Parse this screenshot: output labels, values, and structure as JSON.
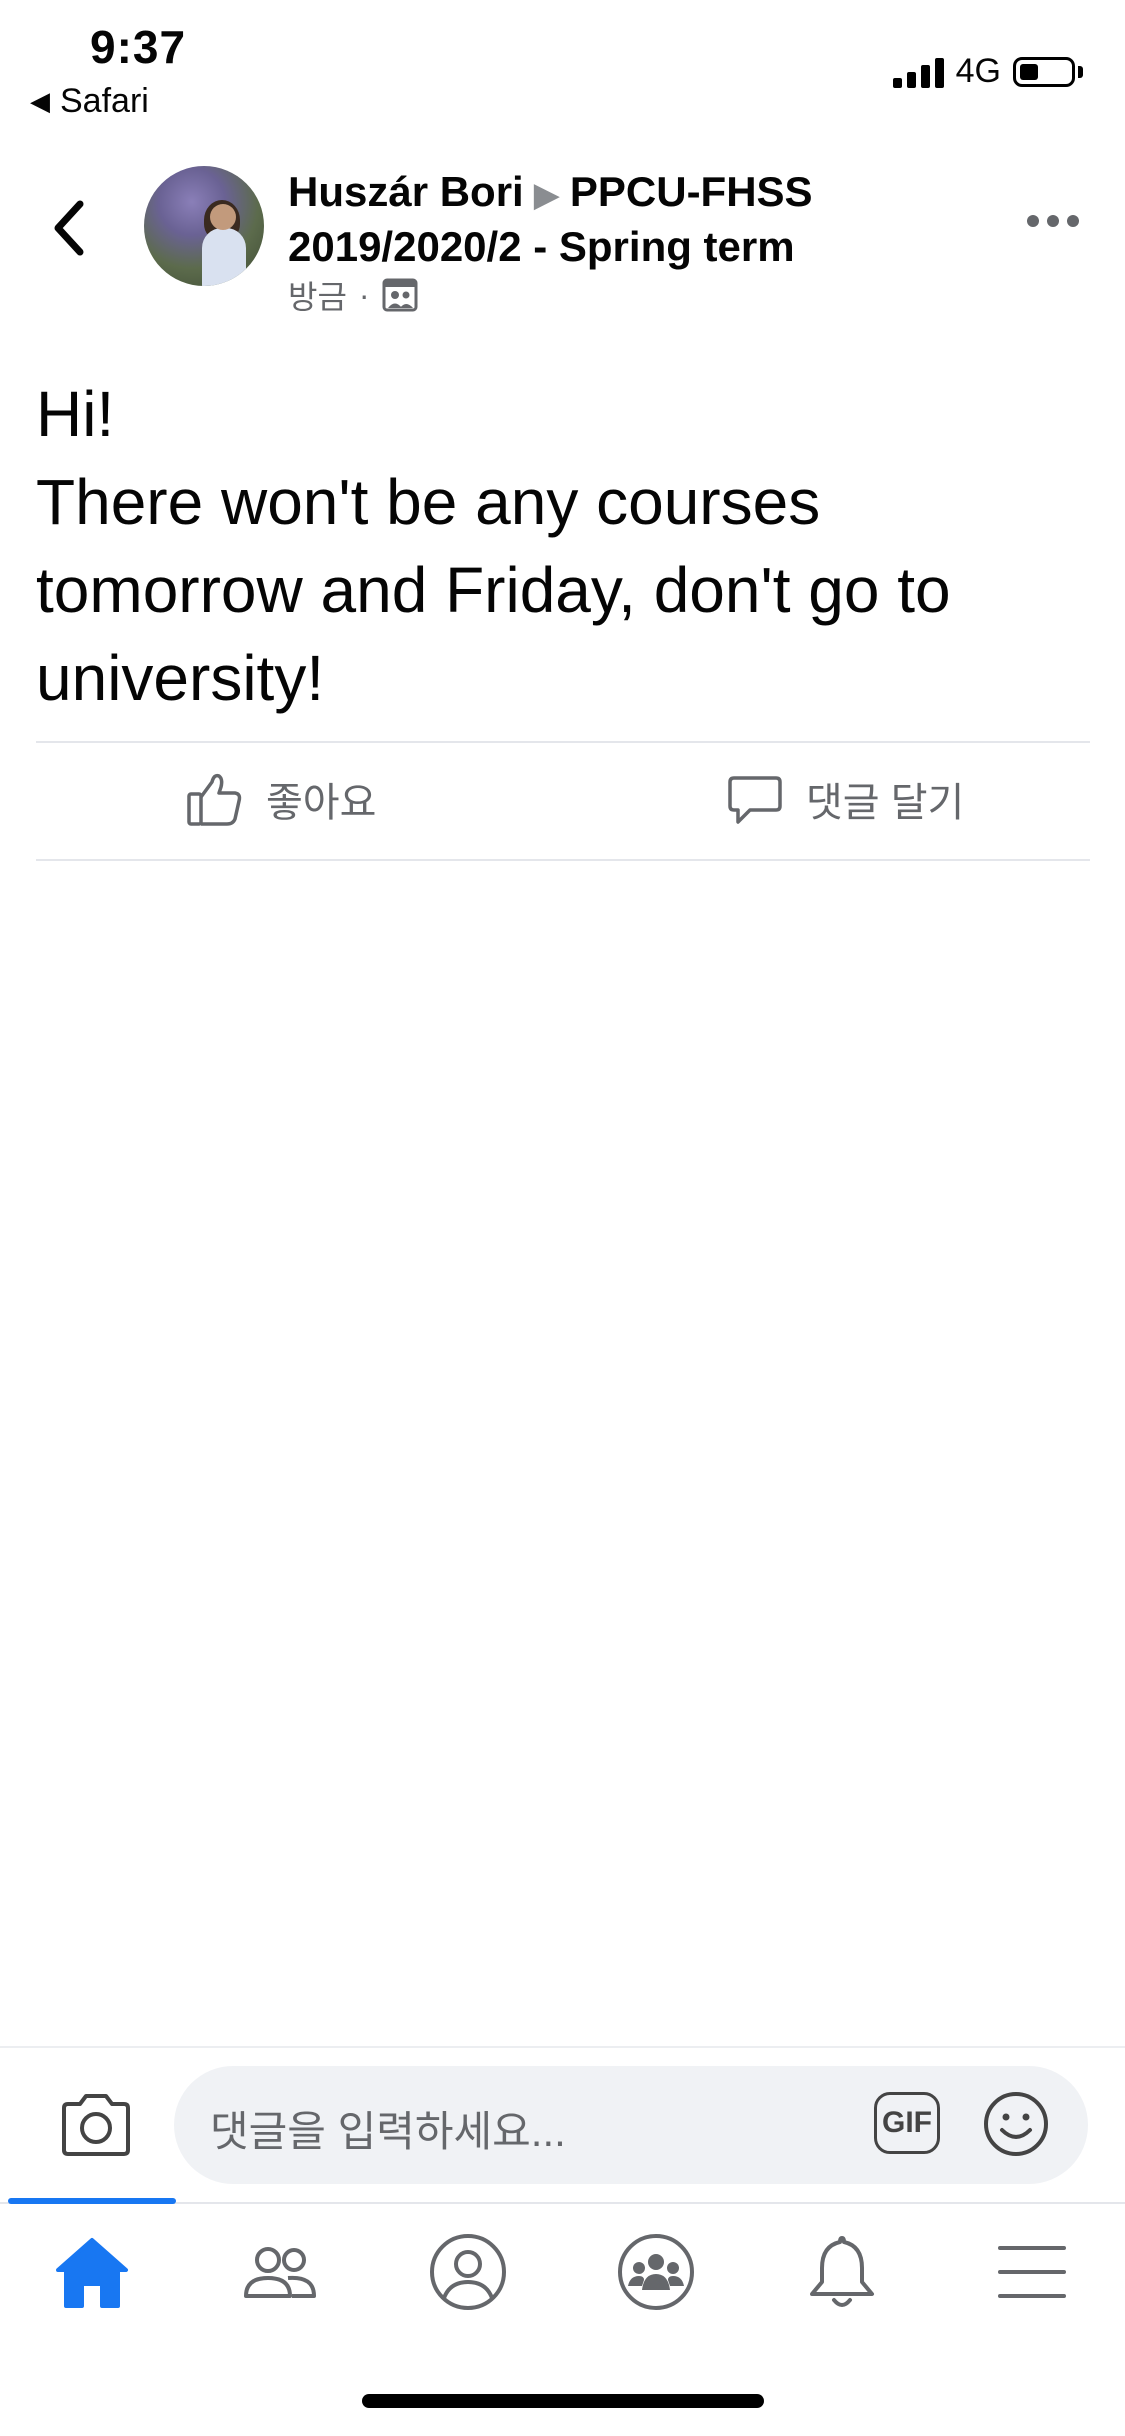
{
  "status_bar": {
    "time": "9:37",
    "back_app": "Safari",
    "network": "4G",
    "battery_fraction": 0.35
  },
  "post": {
    "author": "Huszár Bori",
    "group": "PPCU-FHSS 2019/2020/2 - Spring term",
    "time": "방금",
    "audience_icon": "group-audience-icon",
    "text": "Hi!\nThere won't be any courses tomorrow and Friday, don't go to university!"
  },
  "actions": {
    "like_label": "좋아요",
    "comment_label": "댓글 달기"
  },
  "composer": {
    "placeholder": "댓글을 입력하세요...",
    "gif_label": "GIF"
  },
  "bottom_nav": {
    "items": [
      "home-icon",
      "friends-icon",
      "profile-icon",
      "groups-icon",
      "notifications-icon",
      "menu-icon"
    ],
    "active": "home-icon",
    "accent": "#1877f2"
  }
}
